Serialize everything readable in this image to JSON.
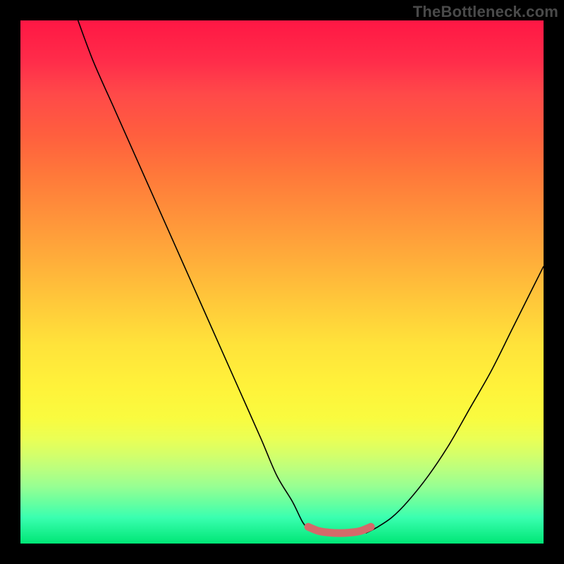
{
  "watermark": "TheBottleneck.com",
  "chart_data": {
    "type": "line",
    "title": "",
    "xlabel": "",
    "ylabel": "",
    "xlim": [
      0,
      100
    ],
    "ylim": [
      0,
      100
    ],
    "series": [
      {
        "name": "left-curve",
        "x": [
          11,
          14,
          18,
          22,
          26,
          30,
          34,
          38,
          42,
          46,
          49,
          52,
          54,
          55.5,
          57
        ],
        "y": [
          100,
          92,
          83,
          74,
          65,
          56,
          47,
          38,
          29,
          20,
          13,
          8,
          4,
          2.5,
          2
        ]
      },
      {
        "name": "right-curve",
        "x": [
          66,
          68,
          71,
          74,
          78,
          82,
          86,
          90,
          94,
          98,
          100
        ],
        "y": [
          2,
          3,
          5,
          8,
          13,
          19,
          26,
          33,
          41,
          49,
          53
        ]
      },
      {
        "name": "bottom-band",
        "x": [
          55,
          57,
          59,
          61,
          63,
          65,
          67
        ],
        "y": [
          3.2,
          2.4,
          2.1,
          2.0,
          2.1,
          2.4,
          3.2
        ]
      }
    ],
    "band_color": "#d46a6a"
  }
}
